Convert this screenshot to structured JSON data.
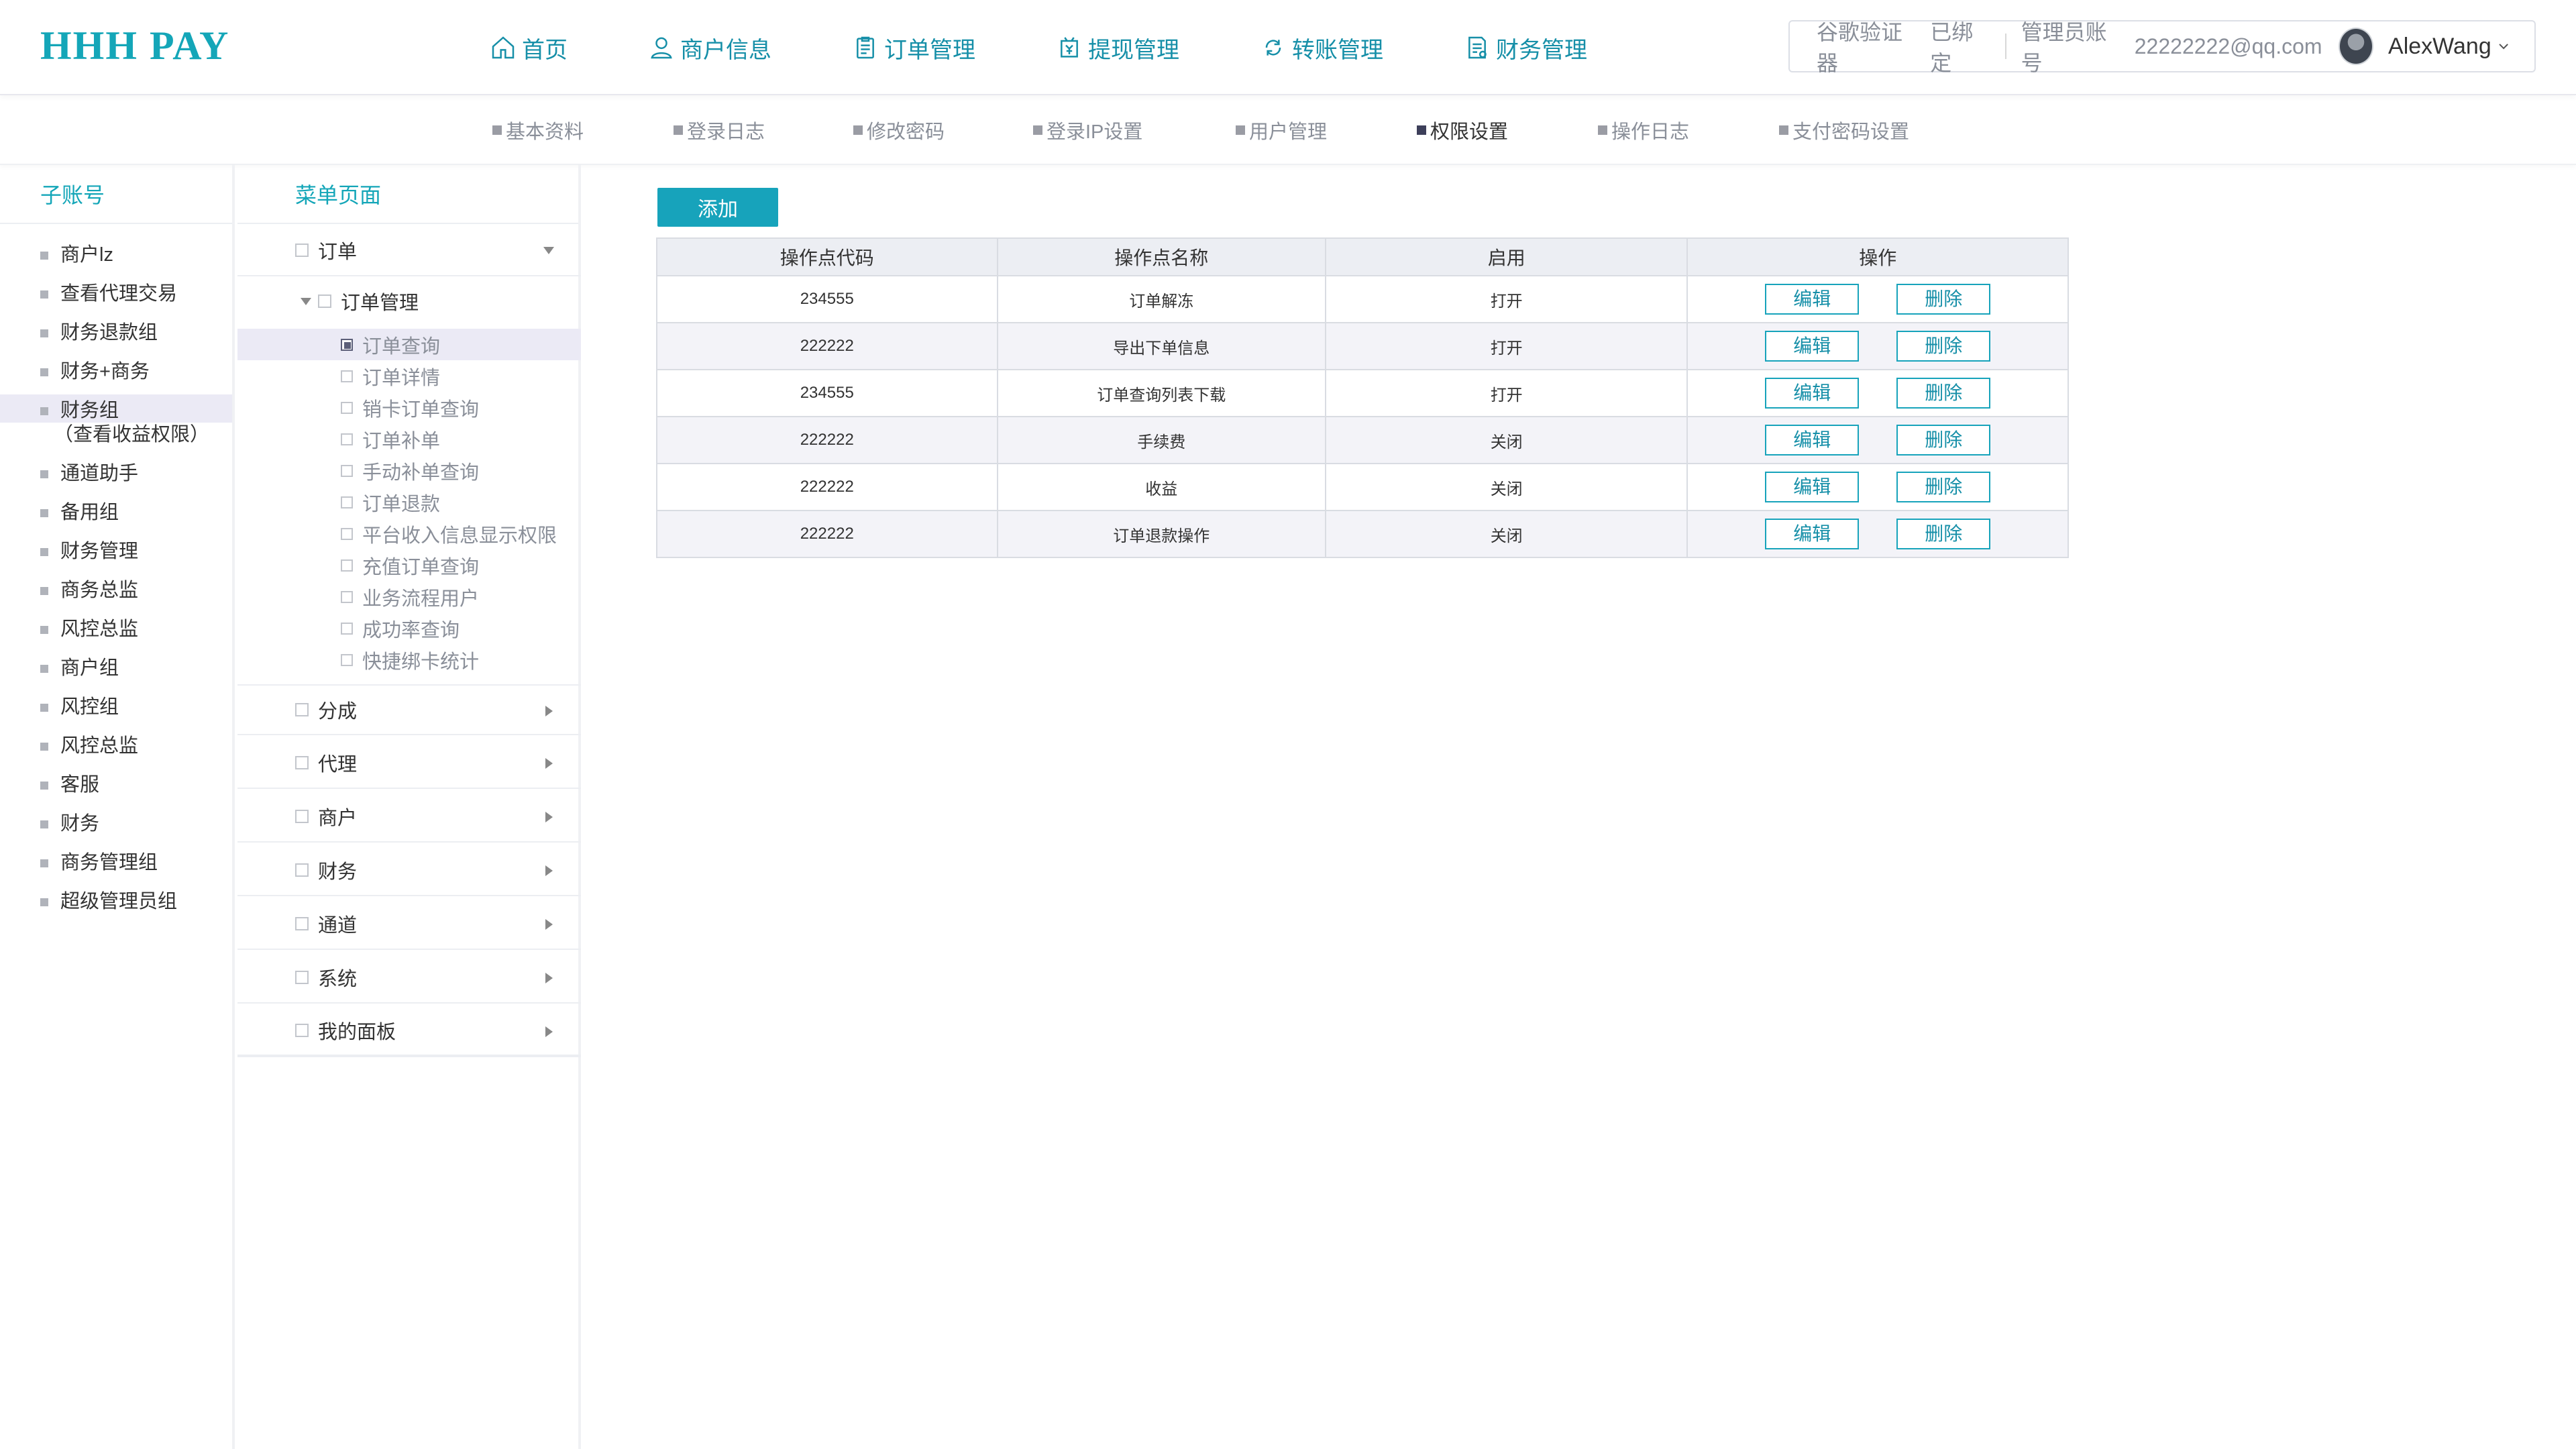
{
  "brand": {
    "logo": "HHH PAY",
    "accent": "#14a6b8"
  },
  "nav": [
    {
      "label": "首页",
      "icon": "home-icon"
    },
    {
      "label": "商户信息",
      "icon": "user-icon"
    },
    {
      "label": "订单管理",
      "icon": "clipboard-icon"
    },
    {
      "label": "提现管理",
      "icon": "wallet-icon"
    },
    {
      "label": "转账管理",
      "icon": "transfer-icon"
    },
    {
      "label": "财务管理",
      "icon": "ledger-icon"
    }
  ],
  "user": {
    "authenticator": "谷歌验证器",
    "bound": "已绑定",
    "admin_label": "管理员账号",
    "admin_email": "22222222@qq.com",
    "name": "AlexWang"
  },
  "subnav": {
    "items": [
      "基本资料",
      "登录日志",
      "修改密码",
      "登录IP设置",
      "用户管理",
      "权限设置",
      "操作日志",
      "支付密码设置"
    ],
    "active": "权限设置"
  },
  "accounts": {
    "title": "子账号",
    "items": [
      "商户lz",
      "查看代理交易",
      "财务退款组",
      "财务+商务",
      "财务组",
      "通道助手",
      "备用组",
      "财务管理",
      "商务总监",
      "风控总监",
      "商户组",
      "风控组",
      "风控总监",
      "客服",
      "财务",
      "商务管理组",
      "超级管理员组"
    ],
    "selected_note": "（查看收益权限）"
  },
  "menu": {
    "title": "菜单页面",
    "top_group": "订单",
    "sub_group": "订单管理",
    "leaves": [
      "订单查询",
      "订单详情",
      "销卡订单查询",
      "订单补单",
      "手动补单查询",
      "订单退款",
      "平台收入信息显示权限",
      "充值订单查询",
      "业务流程用户",
      "成功率查询",
      "快捷绑卡统计"
    ],
    "groups": [
      "分成",
      "代理",
      "商户",
      "财务",
      "通道",
      "系统",
      "我的面板"
    ]
  },
  "content": {
    "add_button": "添加",
    "columns": [
      "操作点代码",
      "操作点名称",
      "启用",
      "操作"
    ],
    "rows": [
      {
        "code": "234555",
        "name": "订单解冻",
        "status": "打开"
      },
      {
        "code": "222222",
        "name": "导出下单信息",
        "status": "打开"
      },
      {
        "code": "234555",
        "name": "订单查询列表下载",
        "status": "打开"
      },
      {
        "code": "222222",
        "name": "手续费",
        "status": "关闭"
      },
      {
        "code": "222222",
        "name": "收益",
        "status": "关闭"
      },
      {
        "code": "222222",
        "name": "订单退款操作",
        "status": "关闭"
      }
    ],
    "edit_label": "编辑",
    "delete_label": "删除",
    "status_colors": {
      "on": "#35b26e",
      "off": "#e0405e"
    }
  }
}
